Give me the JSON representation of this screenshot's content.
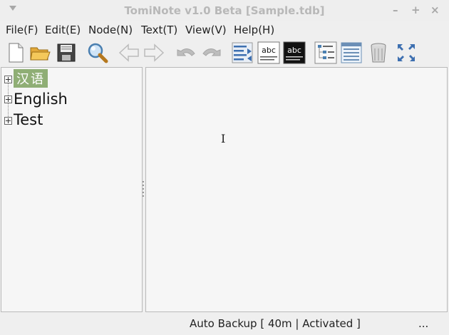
{
  "window": {
    "title": "TomiNote v1.0 Beta [Sample.tdb]",
    "minimize": "–",
    "maximize": "+",
    "close": "×"
  },
  "menubar": {
    "items": [
      "File(F)",
      "Edit(E)",
      "Node(N)",
      "Text(T)",
      "View(V)",
      "Help(H)"
    ]
  },
  "toolbar": {
    "buttons": [
      "new-file",
      "open-folder",
      "save",
      "search",
      "back",
      "forward",
      "undo",
      "redo",
      "swap-text",
      "abc-light",
      "abc-dark",
      "tree-view",
      "list-view",
      "trash",
      "navigation"
    ],
    "abc_light_label": "abc",
    "abc_dark_label": "abc"
  },
  "tree": {
    "nodes": [
      {
        "label": "汉语",
        "selected": true
      },
      {
        "label": "English",
        "selected": false
      },
      {
        "label": "Test",
        "selected": false
      }
    ]
  },
  "editor": {
    "cursor": "I"
  },
  "statusbar": {
    "text": "Auto Backup [ 40m | Activated ]",
    "ellipsis": "..."
  }
}
